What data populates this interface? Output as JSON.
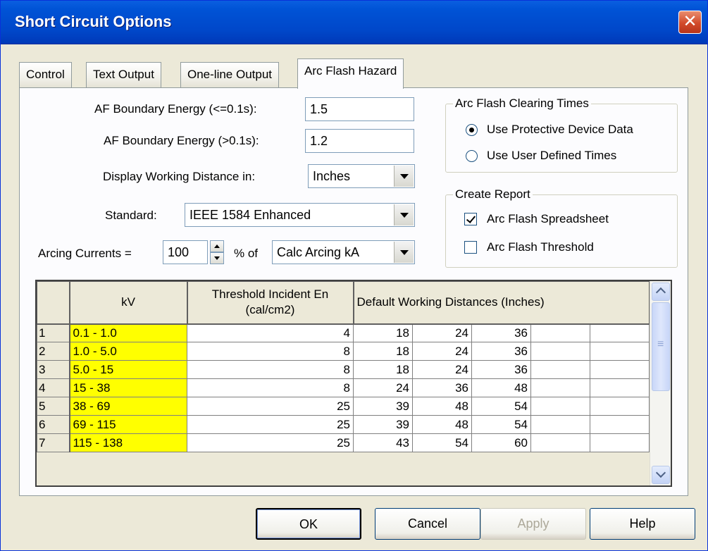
{
  "window": {
    "title": "Short Circuit Options",
    "close": "✕"
  },
  "tabs": [
    {
      "label": "Control"
    },
    {
      "label": "Text Output"
    },
    {
      "label": "One-line Output"
    },
    {
      "label": "Arc Flash Hazard"
    }
  ],
  "form": {
    "af_boundary_le": {
      "label": "AF Boundary Energy (<=0.1s):",
      "value": "1.5"
    },
    "af_boundary_gt": {
      "label": "AF Boundary Energy (>0.1s):",
      "value": "1.2"
    },
    "working_distance": {
      "label": "Display Working Distance in:",
      "value": "Inches"
    },
    "standard": {
      "label": "Standard:",
      "value": "IEEE 1584 Enhanced"
    },
    "arcing_currents": {
      "label": "Arcing Currents =",
      "value": "100",
      "pct_label": "% of",
      "basis": "Calc Arcing kA"
    }
  },
  "clearing_times": {
    "title": "Arc Flash Clearing Times",
    "options": [
      {
        "label": "Use Protective Device Data",
        "selected": true
      },
      {
        "label": "Use User Defined Times",
        "selected": false
      }
    ]
  },
  "create_report": {
    "title": "Create Report",
    "options": [
      {
        "label": "Arc Flash Spreadsheet",
        "checked": true
      },
      {
        "label": "Arc Flash Threshold",
        "checked": false
      }
    ]
  },
  "grid": {
    "headers": {
      "kv": "kV",
      "threshold_l1": "Threshold Incident En",
      "threshold_l2": "(cal/cm2)",
      "distances": "Default Working Distances (Inches)"
    },
    "rows": [
      {
        "n": "1",
        "kv": "0.1 - 1.0",
        "th": "4",
        "d": [
          "18",
          "24",
          "36",
          "",
          ""
        ]
      },
      {
        "n": "2",
        "kv": "1.0 - 5.0",
        "th": "8",
        "d": [
          "18",
          "24",
          "36",
          "",
          ""
        ]
      },
      {
        "n": "3",
        "kv": "5.0 - 15",
        "th": "8",
        "d": [
          "18",
          "24",
          "36",
          "",
          ""
        ]
      },
      {
        "n": "4",
        "kv": "15 - 38",
        "th": "8",
        "d": [
          "24",
          "36",
          "48",
          "",
          ""
        ]
      },
      {
        "n": "5",
        "kv": "38 - 69",
        "th": "25",
        "d": [
          "39",
          "48",
          "54",
          "",
          ""
        ]
      },
      {
        "n": "6",
        "kv": "69 - 115",
        "th": "25",
        "d": [
          "39",
          "48",
          "54",
          "",
          ""
        ]
      },
      {
        "n": "7",
        "kv": "115 - 138",
        "th": "25",
        "d": [
          "43",
          "54",
          "60",
          "",
          ""
        ]
      }
    ]
  },
  "buttons": {
    "ok": "OK",
    "cancel": "Cancel",
    "apply": "Apply",
    "help": "Help"
  }
}
